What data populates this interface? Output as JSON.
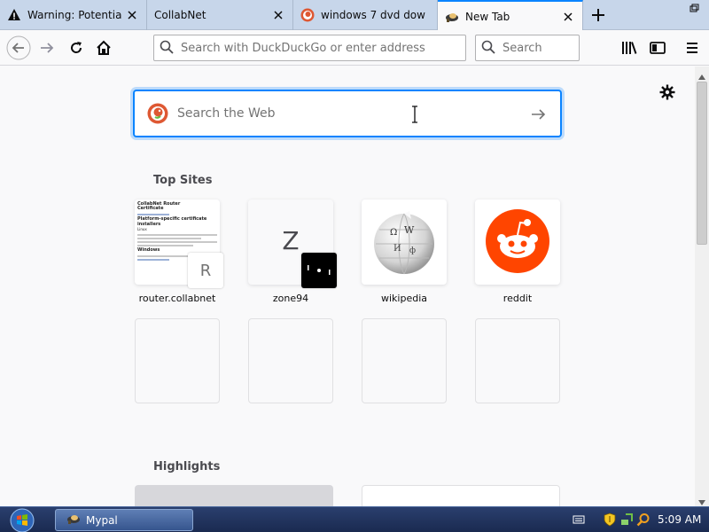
{
  "browser": {
    "tabs": [
      {
        "title": "Warning: Potential",
        "favicon": "warning-icon"
      },
      {
        "title": "CollabNet",
        "favicon": "none"
      },
      {
        "title": "windows 7 dvd dow",
        "favicon": "duckduckgo-icon"
      },
      {
        "title": "New Tab",
        "favicon": "mypal-icon",
        "active": true
      }
    ],
    "url_placeholder": "Search with DuckDuckGo or enter address",
    "search_placeholder": "Search"
  },
  "newtab": {
    "search_placeholder": "Search the Web",
    "top_sites_title": "Top Sites",
    "highlights_title": "Highlights",
    "top_sites": [
      {
        "label": "router.collabnet",
        "badge": "R"
      },
      {
        "label": "zone94",
        "letter": "Z"
      },
      {
        "label": "wikipedia"
      },
      {
        "label": "reddit"
      }
    ],
    "collab_preview": {
      "heading": "CollabNet Router",
      "sub1": "Certificate",
      "sub2": "Platform-specific certificate installers",
      "sub3": "Linux",
      "sub4": "Windows"
    }
  },
  "taskbar": {
    "task_label": "Mypal",
    "clock": "5:09 AM"
  },
  "colors": {
    "accent": "#0a84ff",
    "reddit": "#ff4500",
    "duckduckgo": "#de5833",
    "taskbar": "#1f3260"
  }
}
